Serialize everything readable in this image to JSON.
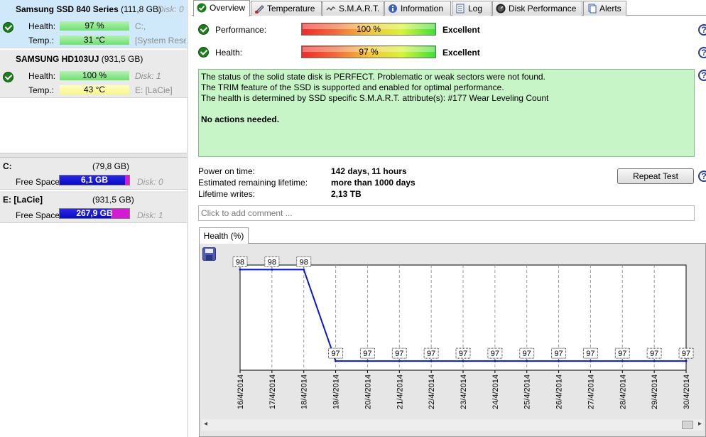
{
  "disks": [
    {
      "title": "Samsung SSD 840 Series",
      "size": "(111,8 GB)",
      "disk_id": "Disk: 0",
      "health_label": "Health:",
      "health_value": "97 %",
      "temp_label": "Temp.:",
      "temp_value": "31 °C",
      "side_health": "C:,",
      "side_temp": "[System Rese"
    },
    {
      "title": "SAMSUNG HD103UJ",
      "size": "(931,5 GB)",
      "disk_id": "",
      "health_label": "Health:",
      "health_value": "100 %",
      "temp_label": "Temp.:",
      "temp_value": "43 °C",
      "side_health": "Disk: 1",
      "side_temp": "E: [LaCie]"
    }
  ],
  "volumes": [
    {
      "title": "C:",
      "size": "(79,8 GB)",
      "free_label": "Free Space",
      "free_value": "6,1 GB",
      "free_fraction": 0.077,
      "disk": "Disk: 0"
    },
    {
      "title": "E: [LaCie]",
      "size": "(931,5 GB)",
      "free_label": "Free Space",
      "free_value": "267,9 GB",
      "free_fraction": 0.29,
      "disk": "Disk: 1"
    }
  ],
  "tabs": [
    {
      "label": "Overview",
      "icon": "check-icon",
      "active": true
    },
    {
      "label": "Temperature",
      "icon": "thermometer-icon"
    },
    {
      "label": "S.M.A.R.T.",
      "icon": "smart-icon"
    },
    {
      "label": "Information",
      "icon": "info-icon"
    },
    {
      "label": "Log",
      "icon": "log-icon"
    },
    {
      "label": "Disk Performance",
      "icon": "gauge-icon"
    },
    {
      "label": "Alerts",
      "icon": "alerts-icon"
    }
  ],
  "overview": {
    "performance_label": "Performance:",
    "performance_value": "100 %",
    "performance_rating": "Excellent",
    "health_label": "Health:",
    "health_value": "97 %",
    "health_rating": "Excellent",
    "status_lines": [
      "The status of the solid state disk is PERFECT. Problematic or weak sectors were not found.",
      "The TRIM feature of the SSD is supported and enabled for optimal performance.",
      "The health is determined by SSD specific S.M.A.R.T. attribute(s):  #177 Wear Leveling Count"
    ],
    "status_action": "No actions needed.",
    "power_on_label": "Power on time:",
    "power_on_value": "142 days, 11 hours",
    "remaining_label": "Estimated remaining lifetime:",
    "remaining_value": "more than 1000 days",
    "writes_label": "Lifetime writes:",
    "writes_value": "2,13 TB",
    "repeat_button": "Repeat Test",
    "comment_placeholder": "Click to add comment ...",
    "help_symbol": "?"
  },
  "chart_tab_label": "Health (%)",
  "chart_data": {
    "type": "line",
    "title": "",
    "x": [
      "16/4/2014",
      "17/4/2014",
      "18/4/2014",
      "19/4/2014",
      "20/4/2014",
      "21/4/2014",
      "22/4/2014",
      "23/4/2014",
      "24/4/2014",
      "25/4/2014",
      "26/4/2014",
      "27/4/2014",
      "28/4/2014",
      "29/4/2014",
      "30/4/2014"
    ],
    "values": [
      98,
      98,
      98,
      97,
      97,
      97,
      97,
      97,
      97,
      97,
      97,
      97,
      97,
      97,
      97
    ],
    "ylim": [
      96.9,
      98.05
    ],
    "grid": true,
    "color": "#0b18c8"
  }
}
